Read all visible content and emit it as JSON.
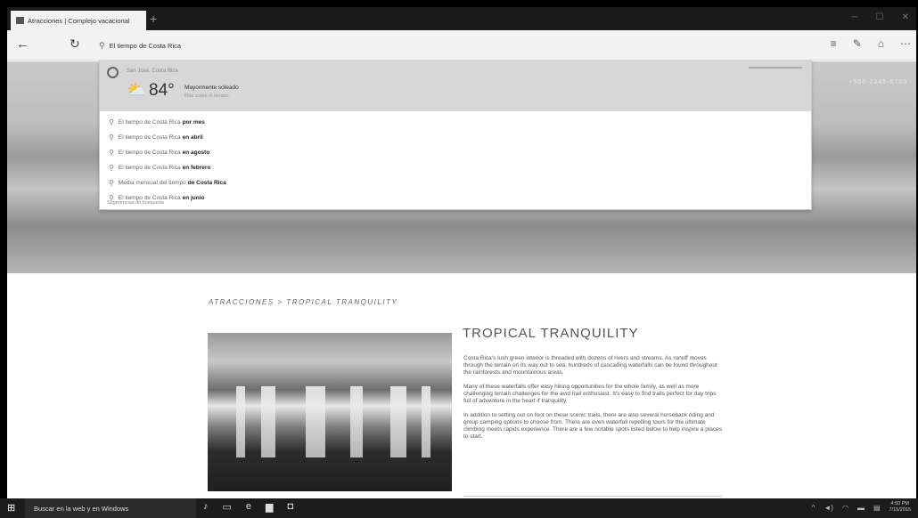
{
  "browser": {
    "tab_title": "Atracciones | Complejo vacacional",
    "new_tab": "+",
    "address_text": "El tiempo de Costa Rica"
  },
  "weather": {
    "location": "San José, Costa Rica",
    "temperature": "84°",
    "condition": "Mayormente soleado",
    "subtext": "Más sobre el tiempo"
  },
  "suggestions": [
    {
      "prefix": "El tiempo de Costa Rica",
      "bold": "por mes"
    },
    {
      "prefix": "El tiempo de Costa Rica",
      "bold": "en abril"
    },
    {
      "prefix": "El tiempo de Costa Rica",
      "bold": "en agosto"
    },
    {
      "prefix": "El tiempo de Costa Rica",
      "bold": "en febrero"
    },
    {
      "prefix": "Media mensual del tiempo",
      "bold": "de Costa Rica"
    },
    {
      "prefix": "El tiempo de Costa Rica",
      "bold": "en junio"
    }
  ],
  "suggestions_footer": "Sugerencias de búsqueda",
  "page": {
    "phone": "+506-2345-6789",
    "breadcrumb": "ATRACCIONES > TROPICAL TRANQUILITY",
    "title": "TROPICAL TRANQUILITY",
    "paragraphs": [
      "Costa Rica's lush green interior is threaded with dozens of rivers and streams. As runoff moves through the terrain on its way out to sea, hundreds of cascading waterfalls can be found throughout the rainforests and mountainous areas.",
      "Many of these waterfalls offer easy hiking opportunities for the whole family, as well as more challenging terrain challenges for the avid trail enthusiast. It's easy to find trails perfect for day trips full of adventure in the heart if tranquility.",
      "In addition to setting out on foot on these scenic trails, there are also several horseback riding and group camping options to choose from. There are even waterfall repelling tours for the ultimate climbing meets rapids experience. There are a few notable spots listed below to help inspire a places to start."
    ]
  },
  "taskbar": {
    "search_text": "Buscar en la web y en Windows",
    "time": "4:50 PM",
    "date": "7/15/2015"
  }
}
